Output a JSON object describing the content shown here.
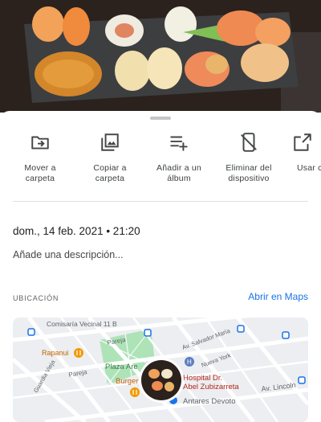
{
  "photo": {
    "icon": "sushi-photo"
  },
  "actions": [
    {
      "label": "Mover a\ncarpeta",
      "icon": "move-to-folder-icon"
    },
    {
      "label": "Copiar a\ncarpeta",
      "icon": "copy-image-icon"
    },
    {
      "label": "Añadir a un\nálbum",
      "icon": "playlist-add-icon"
    },
    {
      "label": "Eliminar del\ndispositivo",
      "icon": "phone-delete-icon"
    },
    {
      "label": "Usar c",
      "icon": "open-external-icon"
    }
  ],
  "details": {
    "datetime": "dom., 14 feb. 2021 • 21:20",
    "description_placeholder": "Añade una descripción..."
  },
  "location": {
    "heading": "UBICACIÓN",
    "open_maps": "Abrir en Maps"
  },
  "map": {
    "labels": {
      "comisaria": "Comisaría Vecinal 11 B",
      "rapanui": "Rapanui",
      "pareja": "Pareja",
      "pareja2": "Pareja",
      "guardia": "Guardia Vieja",
      "plaza": "Plaza Are",
      "burger": "Burger",
      "hospital": "Hospital Dr.",
      "hospital2": "Abel Zubizarreta",
      "antares": "Antares Devoto",
      "lincoln": "Av. Lincoln",
      "salvador": "Av. Salvador María",
      "nuevayork": "Nueva York"
    },
    "colors": {
      "park": "#aee3b8",
      "water": "#aadaff",
      "road": "#ffffff",
      "pin_orange": "#f29900",
      "pin_blue": "#1a73e8"
    }
  }
}
